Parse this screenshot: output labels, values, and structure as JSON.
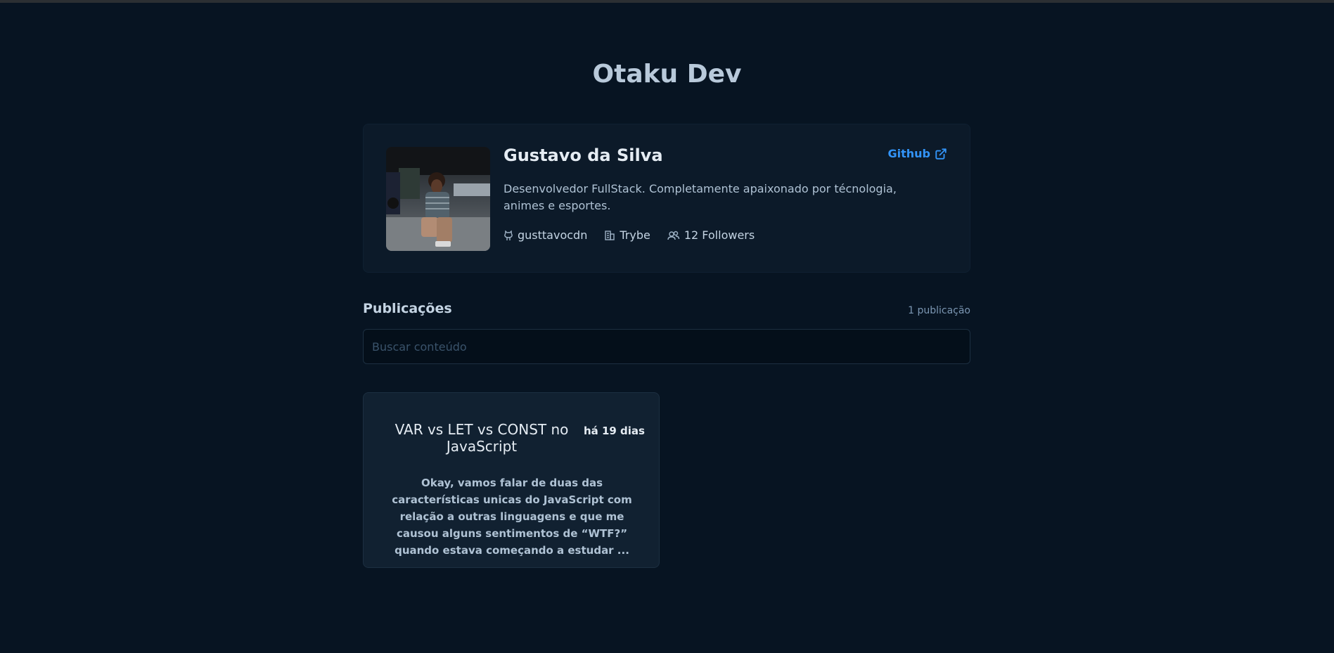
{
  "header": {
    "title": "Otaku Dev"
  },
  "profile": {
    "name": "Gustavo da Silva",
    "github_label": "Github",
    "bio": "Desenvolvedor FullStack. Completamente apaixonado por técnologia, animes e esportes.",
    "username": "gusttavocdn",
    "company": "Trybe",
    "followers": "12 Followers",
    "avatar_icon": "avatar-photo"
  },
  "publications": {
    "title": "Publicações",
    "count": "1 publicação",
    "search_placeholder": "Buscar conteúdo",
    "search_value": ""
  },
  "posts": [
    {
      "title": "VAR vs LET vs CONST no JavaScript",
      "date": "há 19 dias",
      "excerpt": "Okay, vamos falar de duas das características unicas do JavaScript com relação a outras linguagens e que me causou alguns sentimentos de “WTF?” quando estava começando a estudar ..."
    }
  ],
  "colors": {
    "background": "#071422",
    "card": "#0c1a29",
    "post_card": "#112131",
    "accent": "#3294f8",
    "title": "#e5ecf3",
    "text": "#c4d4e3"
  },
  "icons": {
    "github": "github-icon",
    "company": "building-icon",
    "followers": "users-icon",
    "external": "external-link-icon"
  }
}
